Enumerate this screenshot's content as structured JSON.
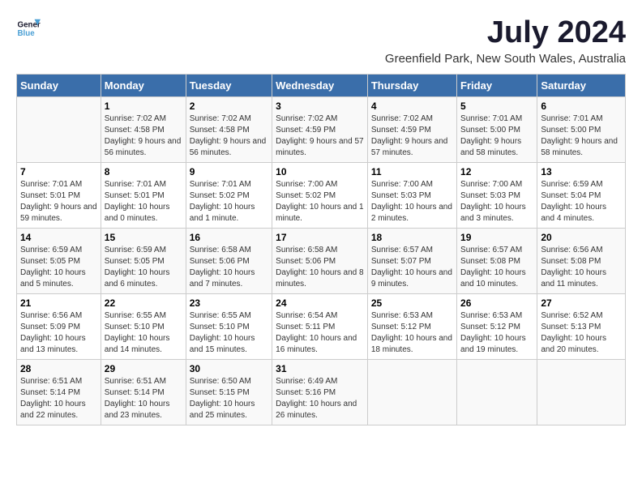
{
  "logo": {
    "line1": "General",
    "line2": "Blue"
  },
  "title": "July 2024",
  "subtitle": "Greenfield Park, New South Wales, Australia",
  "headers": [
    "Sunday",
    "Monday",
    "Tuesday",
    "Wednesday",
    "Thursday",
    "Friday",
    "Saturday"
  ],
  "weeks": [
    [
      {
        "day": "",
        "sunrise": "",
        "sunset": "",
        "daylight": ""
      },
      {
        "day": "1",
        "sunrise": "7:02 AM",
        "sunset": "4:58 PM",
        "daylight": "9 hours and 56 minutes."
      },
      {
        "day": "2",
        "sunrise": "7:02 AM",
        "sunset": "4:58 PM",
        "daylight": "9 hours and 56 minutes."
      },
      {
        "day": "3",
        "sunrise": "7:02 AM",
        "sunset": "4:59 PM",
        "daylight": "9 hours and 57 minutes."
      },
      {
        "day": "4",
        "sunrise": "7:02 AM",
        "sunset": "4:59 PM",
        "daylight": "9 hours and 57 minutes."
      },
      {
        "day": "5",
        "sunrise": "7:01 AM",
        "sunset": "5:00 PM",
        "daylight": "9 hours and 58 minutes."
      },
      {
        "day": "6",
        "sunrise": "7:01 AM",
        "sunset": "5:00 PM",
        "daylight": "9 hours and 58 minutes."
      }
    ],
    [
      {
        "day": "7",
        "sunrise": "7:01 AM",
        "sunset": "5:01 PM",
        "daylight": "9 hours and 59 minutes."
      },
      {
        "day": "8",
        "sunrise": "7:01 AM",
        "sunset": "5:01 PM",
        "daylight": "10 hours and 0 minutes."
      },
      {
        "day": "9",
        "sunrise": "7:01 AM",
        "sunset": "5:02 PM",
        "daylight": "10 hours and 1 minute."
      },
      {
        "day": "10",
        "sunrise": "7:00 AM",
        "sunset": "5:02 PM",
        "daylight": "10 hours and 1 minute."
      },
      {
        "day": "11",
        "sunrise": "7:00 AM",
        "sunset": "5:03 PM",
        "daylight": "10 hours and 2 minutes."
      },
      {
        "day": "12",
        "sunrise": "7:00 AM",
        "sunset": "5:03 PM",
        "daylight": "10 hours and 3 minutes."
      },
      {
        "day": "13",
        "sunrise": "6:59 AM",
        "sunset": "5:04 PM",
        "daylight": "10 hours and 4 minutes."
      }
    ],
    [
      {
        "day": "14",
        "sunrise": "6:59 AM",
        "sunset": "5:05 PM",
        "daylight": "10 hours and 5 minutes."
      },
      {
        "day": "15",
        "sunrise": "6:59 AM",
        "sunset": "5:05 PM",
        "daylight": "10 hours and 6 minutes."
      },
      {
        "day": "16",
        "sunrise": "6:58 AM",
        "sunset": "5:06 PM",
        "daylight": "10 hours and 7 minutes."
      },
      {
        "day": "17",
        "sunrise": "6:58 AM",
        "sunset": "5:06 PM",
        "daylight": "10 hours and 8 minutes."
      },
      {
        "day": "18",
        "sunrise": "6:57 AM",
        "sunset": "5:07 PM",
        "daylight": "10 hours and 9 minutes."
      },
      {
        "day": "19",
        "sunrise": "6:57 AM",
        "sunset": "5:08 PM",
        "daylight": "10 hours and 10 minutes."
      },
      {
        "day": "20",
        "sunrise": "6:56 AM",
        "sunset": "5:08 PM",
        "daylight": "10 hours and 11 minutes."
      }
    ],
    [
      {
        "day": "21",
        "sunrise": "6:56 AM",
        "sunset": "5:09 PM",
        "daylight": "10 hours and 13 minutes."
      },
      {
        "day": "22",
        "sunrise": "6:55 AM",
        "sunset": "5:10 PM",
        "daylight": "10 hours and 14 minutes."
      },
      {
        "day": "23",
        "sunrise": "6:55 AM",
        "sunset": "5:10 PM",
        "daylight": "10 hours and 15 minutes."
      },
      {
        "day": "24",
        "sunrise": "6:54 AM",
        "sunset": "5:11 PM",
        "daylight": "10 hours and 16 minutes."
      },
      {
        "day": "25",
        "sunrise": "6:53 AM",
        "sunset": "5:12 PM",
        "daylight": "10 hours and 18 minutes."
      },
      {
        "day": "26",
        "sunrise": "6:53 AM",
        "sunset": "5:12 PM",
        "daylight": "10 hours and 19 minutes."
      },
      {
        "day": "27",
        "sunrise": "6:52 AM",
        "sunset": "5:13 PM",
        "daylight": "10 hours and 20 minutes."
      }
    ],
    [
      {
        "day": "28",
        "sunrise": "6:51 AM",
        "sunset": "5:14 PM",
        "daylight": "10 hours and 22 minutes."
      },
      {
        "day": "29",
        "sunrise": "6:51 AM",
        "sunset": "5:14 PM",
        "daylight": "10 hours and 23 minutes."
      },
      {
        "day": "30",
        "sunrise": "6:50 AM",
        "sunset": "5:15 PM",
        "daylight": "10 hours and 25 minutes."
      },
      {
        "day": "31",
        "sunrise": "6:49 AM",
        "sunset": "5:16 PM",
        "daylight": "10 hours and 26 minutes."
      },
      {
        "day": "",
        "sunrise": "",
        "sunset": "",
        "daylight": ""
      },
      {
        "day": "",
        "sunrise": "",
        "sunset": "",
        "daylight": ""
      },
      {
        "day": "",
        "sunrise": "",
        "sunset": "",
        "daylight": ""
      }
    ]
  ]
}
